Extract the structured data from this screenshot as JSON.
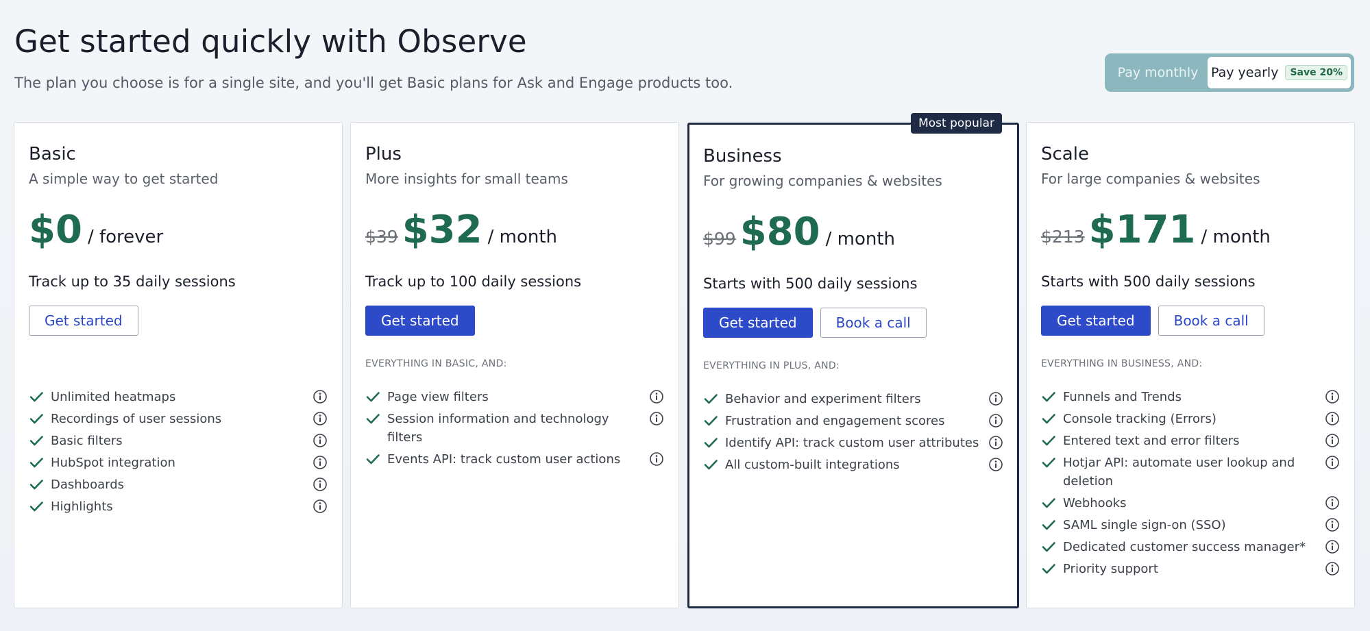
{
  "header": {
    "title": "Get started quickly with Observe",
    "subtitle": "The plan you choose is for a single site, and you'll get Basic plans for Ask and Engage products too."
  },
  "billing_toggle": {
    "monthly_label": "Pay monthly",
    "yearly_label": "Pay yearly",
    "save_badge": "Save 20%",
    "selected": "yearly"
  },
  "colors": {
    "price": "#1f6b4f",
    "primary_button": "#2d4bc8",
    "check": "#1f6b4f",
    "toggle_bg": "#8db7bf",
    "featured_border": "#1f2a44"
  },
  "plans": [
    {
      "name": "Basic",
      "tagline": "A simple way to get started",
      "old_price": "",
      "price": "$0",
      "period": "/ forever",
      "sessions": "Track up to 35 daily sessions",
      "primary_button": "Get started",
      "section_label": "",
      "features": [
        "Unlimited heatmaps",
        "Recordings of user sessions",
        "Basic filters",
        "HubSpot integration",
        "Dashboards",
        "Highlights"
      ]
    },
    {
      "name": "Plus",
      "tagline": "More insights for small teams",
      "old_price": "$39",
      "price": "$32",
      "period": "/ month",
      "sessions": "Track up to 100 daily sessions",
      "primary_button": "Get started",
      "section_label": "EVERYTHING IN BASIC, AND:",
      "features": [
        "Page view filters",
        "Session information and technology filters",
        "Events API: track custom user actions"
      ]
    },
    {
      "name": "Business",
      "badge": "Most popular",
      "tagline": "For growing companies & websites",
      "old_price": "$99",
      "price": "$80",
      "period": "/ month",
      "sessions": "Starts with 500 daily sessions",
      "primary_button": "Get started",
      "secondary_button": "Book a call",
      "section_label": "EVERYTHING IN PLUS, AND:",
      "features": [
        "Behavior and experiment filters",
        "Frustration and engagement scores",
        "Identify API: track custom user attributes",
        "All custom-built integrations"
      ]
    },
    {
      "name": "Scale",
      "tagline": "For large companies & websites",
      "old_price": "$213",
      "price": "$171",
      "period": "/ month",
      "sessions": "Starts with 500 daily sessions",
      "primary_button": "Get started",
      "secondary_button": "Book a call",
      "section_label": "EVERYTHING IN BUSINESS, AND:",
      "features": [
        "Funnels and Trends",
        "Console tracking (Errors)",
        "Entered text and error filters",
        "Hotjar API: automate user lookup and deletion",
        "Webhooks",
        "SAML single sign-on (SSO)",
        "Dedicated customer success manager*",
        "Priority support"
      ]
    }
  ]
}
